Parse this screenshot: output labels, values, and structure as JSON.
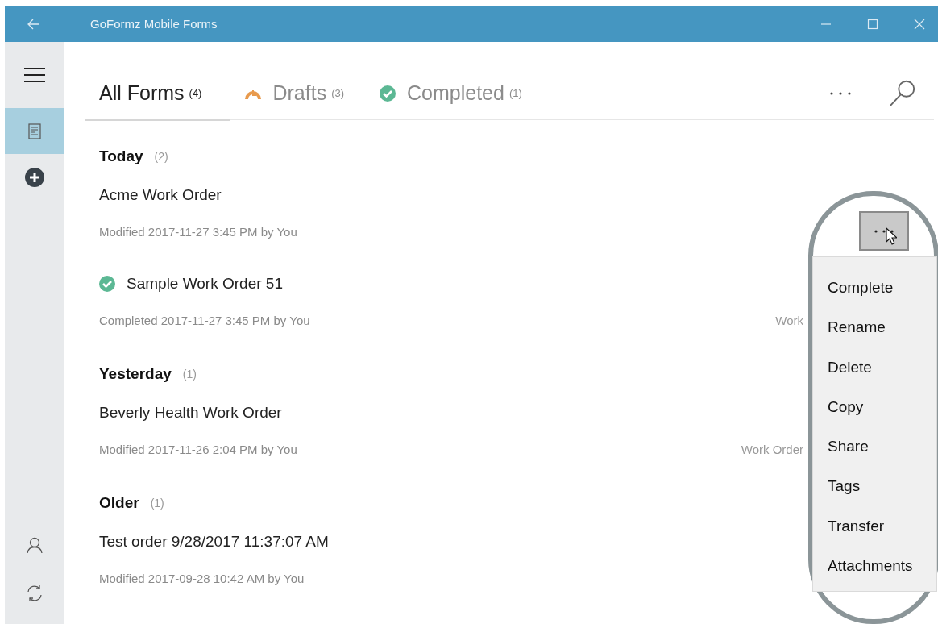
{
  "window": {
    "title": "GoFormz Mobile Forms"
  },
  "sidebar": {
    "items": [
      {
        "kind": "menu",
        "selected": false
      },
      {
        "kind": "forms",
        "selected": true
      },
      {
        "kind": "add",
        "selected": false
      }
    ],
    "bottom_items": [
      {
        "kind": "account"
      },
      {
        "kind": "sync"
      }
    ]
  },
  "tabs": [
    {
      "kind": "all",
      "label": "All Forms",
      "count": "(4)",
      "selected": true
    },
    {
      "kind": "draft",
      "label": "Drafts",
      "count": "(3)",
      "selected": false
    },
    {
      "kind": "completed",
      "label": "Completed",
      "count": "(1)",
      "selected": false
    }
  ],
  "groups": [
    {
      "title": "Today",
      "count": "(2)",
      "forms": [
        {
          "name": "Acme Work Order",
          "completed": false,
          "meta": "Modified 2017-11-27 3:45 PM by You"
        },
        {
          "name": "Sample Work Order 51",
          "completed": true,
          "meta": "Completed 2017-11-27 3:45 PM by You",
          "tag": "Work"
        }
      ]
    },
    {
      "title": "Yesterday",
      "count": "(1)",
      "forms": [
        {
          "name": "Beverly Health Work Order",
          "completed": false,
          "meta": "Modified 2017-11-26 2:04 PM by You",
          "tag": "Work Order"
        }
      ]
    },
    {
      "title": "Older",
      "count": "(1)",
      "forms": [
        {
          "name": "Test order 9/28/2017 11:37:07 AM",
          "completed": false,
          "meta": "Modified 2017-09-28 10:42 AM by You"
        }
      ]
    }
  ],
  "context_menu": {
    "items": [
      "Complete",
      "Rename",
      "Delete",
      "Copy",
      "Share",
      "Tags",
      "Transfer",
      "Attachments"
    ]
  }
}
